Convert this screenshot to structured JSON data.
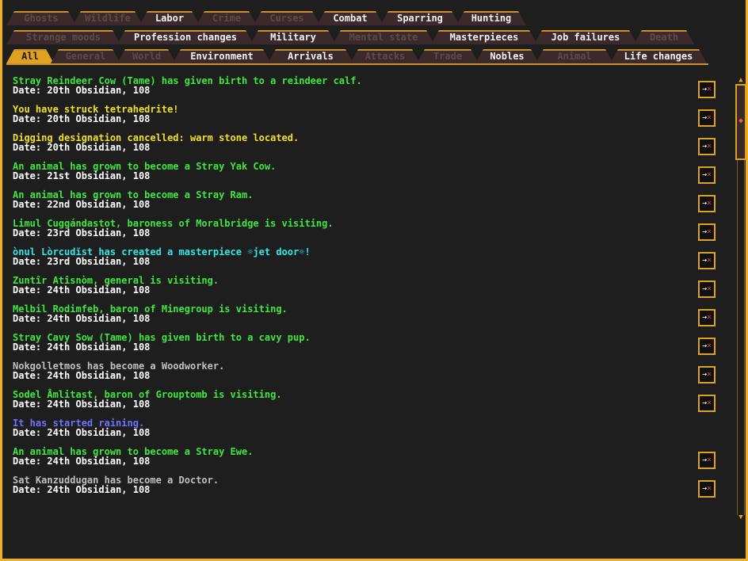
{
  "tabs_row1": [
    {
      "label": "Ghosts",
      "state": "dim"
    },
    {
      "label": "Wildlife",
      "state": "dim"
    },
    {
      "label": "Labor",
      "state": "on"
    },
    {
      "label": "Crime",
      "state": "dim"
    },
    {
      "label": "Curses",
      "state": "dim"
    },
    {
      "label": "Combat",
      "state": "on"
    },
    {
      "label": "Sparring",
      "state": "on"
    },
    {
      "label": "Hunting",
      "state": "on"
    }
  ],
  "tabs_row2": [
    {
      "label": "Strange moods",
      "state": "dim"
    },
    {
      "label": "Profession changes",
      "state": "on"
    },
    {
      "label": "Military",
      "state": "on"
    },
    {
      "label": "Mental state",
      "state": "dim"
    },
    {
      "label": "Masterpieces",
      "state": "on"
    },
    {
      "label": "Job failures",
      "state": "on"
    },
    {
      "label": "Death",
      "state": "dim"
    }
  ],
  "tabs_row3": [
    {
      "label": "All",
      "state": "sel"
    },
    {
      "label": "General",
      "state": "dim"
    },
    {
      "label": "World",
      "state": "dim"
    },
    {
      "label": "Environment",
      "state": "on"
    },
    {
      "label": "Arrivals",
      "state": "on"
    },
    {
      "label": "Attacks",
      "state": "dim"
    },
    {
      "label": "Trade",
      "state": "dim"
    },
    {
      "label": "Nobles",
      "state": "on"
    },
    {
      "label": "Animal",
      "state": "dim"
    },
    {
      "label": "Life changes",
      "state": "on"
    }
  ],
  "colors": {
    "green": "#3ee83e",
    "yellow": "#f0e020",
    "cyan": "#30e8e8",
    "grey": "#c0c0c0",
    "blue": "#7070ff"
  },
  "zoom_icon": "zoom-to-location-icon",
  "entries": [
    {
      "text": "Stray Reindeer Cow (Tame) has given birth to a reindeer calf.",
      "date": "Date: 20th Obsidian, 108",
      "color": "#3ee83e",
      "zoom": true
    },
    {
      "text": "You have struck tetrahedrite!",
      "date": "Date: 20th Obsidian, 108",
      "color": "#f0e020",
      "zoom": true
    },
    {
      "text": "Digging designation cancelled: warm stone located.",
      "date": "Date: 20th Obsidian, 108",
      "color": "#f0e020",
      "zoom": true
    },
    {
      "text": "An animal has grown to become a Stray Yak Cow.",
      "date": "Date: 21st Obsidian, 108",
      "color": "#3ee83e",
      "zoom": true
    },
    {
      "text": "An animal has grown to become a Stray Ram.",
      "date": "Date: 22nd Obsidian, 108",
      "color": "#3ee83e",
      "zoom": true
    },
    {
      "text": "Limul Cuggándastot, baroness of Moralbridge is visiting.",
      "date": "Date: 23rd Obsidian, 108",
      "color": "#3ee83e",
      "zoom": true
    },
    {
      "text": "ònul Lòrcudïst has created a masterpiece ☼jet door☼!",
      "date": "Date: 23rd Obsidian, 108",
      "color": "#30e8e8",
      "zoom": true
    },
    {
      "text": "Zuntîr Atîsnòm, general is visiting.",
      "date": "Date: 24th Obsidian, 108",
      "color": "#3ee83e",
      "zoom": true
    },
    {
      "text": "Melbil Rodimfeb, baron of Minegroup is visiting.",
      "date": "Date: 24th Obsidian, 108",
      "color": "#3ee83e",
      "zoom": true
    },
    {
      "text": "Stray Cavy Sow (Tame) has given birth to a cavy pup.",
      "date": "Date: 24th Obsidian, 108",
      "color": "#3ee83e",
      "zoom": true
    },
    {
      "text": "Nokgolletmos has become a Woodworker.",
      "date": "Date: 24th Obsidian, 108",
      "color": "#c0c0c0",
      "zoom": true
    },
    {
      "text": "Sodel Åmlitast, baron of Grouptomb is visiting.",
      "date": "Date: 24th Obsidian, 108",
      "color": "#3ee83e",
      "zoom": true
    },
    {
      "text": "It has started raining.",
      "date": "Date: 24th Obsidian, 108",
      "color": "#7070ff",
      "zoom": false
    },
    {
      "text": "An animal has grown to become a Stray Ewe.",
      "date": "Date: 24th Obsidian, 108",
      "color": "#3ee83e",
      "zoom": true
    },
    {
      "text": "Sat Kanzuddugan has become a Doctor.",
      "date": "Date: 24th Obsidian, 108",
      "color": "#c0c0c0",
      "zoom": true
    }
  ]
}
